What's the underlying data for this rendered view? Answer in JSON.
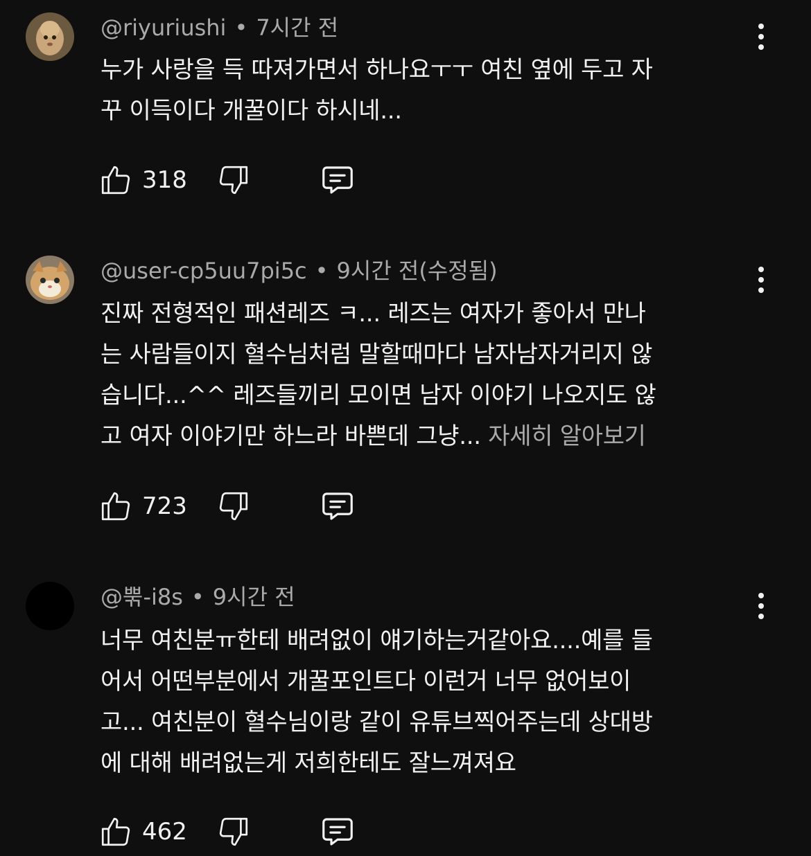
{
  "comments": [
    {
      "author": "@riyuriushi",
      "separator": "•",
      "time": "7시간 전",
      "lines": [
        "누가 사랑을 득 따져가면서 하나요ㅜㅜ 여친 옆에 두고 자",
        "꾸 이득이다 개꿀이다 하시네..."
      ],
      "more_label": "",
      "likes": "318",
      "avatar_icon": "doll-avatar-icon"
    },
    {
      "author": "@user-cp5uu7pi5c",
      "separator": "•",
      "time": "9시간 전(수정됨)",
      "lines": [
        "진짜 전형적인 패션레즈 ㅋ... 레즈는 여자가 좋아서 만나",
        "는 사람들이지 혈수님처럼 말할때마다 남자남자거리지 않",
        "습니다...^^ 레즈들끼리 모이면 남자 이야기 나오지도 않",
        "고 여자 이야기만 하느라 바쁜데 그냥... "
      ],
      "more_label": "자세히 알아보기",
      "likes": "723",
      "avatar_icon": "cat-avatar-icon"
    },
    {
      "author": "@뿎-i8s",
      "separator": "•",
      "time": "9시간 전",
      "lines": [
        "너무 여친분ㅠ한테 배려없이 얘기하는거같아요....예를 들",
        "어서 어떤부분에서 개꿀포인트다 이런거 너무 없어보이",
        "고... 여친분이 혈수님이랑 같이 유튜브찍어주는데 상대방",
        "에 대해 배려없는게 저희한테도 잘느껴져요"
      ],
      "more_label": "",
      "likes": "462",
      "avatar_icon": "blank-avatar-icon"
    }
  ],
  "colors": {
    "background": "#0f0f0f",
    "text_primary": "#f1f1f1",
    "text_secondary": "#aaaaaa"
  },
  "icons": {
    "like": "thumbs-up-icon",
    "dislike": "thumbs-down-icon",
    "reply": "reply-comment-icon",
    "menu": "more-vert-icon"
  }
}
